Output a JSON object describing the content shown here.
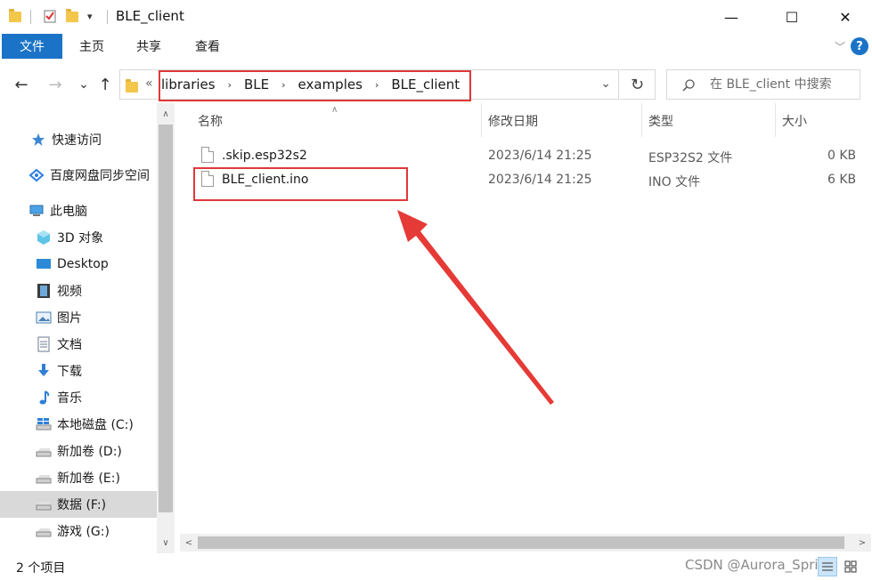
{
  "window": {
    "title": "BLE_client",
    "quick_access_dropdown": "▾",
    "minimize_glyph": "—",
    "maximize_glyph": "☐",
    "close_glyph": "✕"
  },
  "ribbon": {
    "tabs": [
      "文件",
      "主页",
      "共享",
      "查看"
    ],
    "collapse_glyph": "﹀",
    "help_glyph": "?"
  },
  "nav": {
    "back_glyph": "←",
    "forward_glyph": "→",
    "recent_glyph": "⌄",
    "up_glyph": "↑",
    "overflow_glyph": "«",
    "breadcrumbs": [
      "libraries",
      "BLE",
      "examples",
      "BLE_client"
    ],
    "crumb_separator": "›",
    "address_dropdown_glyph": "⌄",
    "refresh_glyph": "↻",
    "search_placeholder": "在 BLE_client 中搜索"
  },
  "sidebar": {
    "items": [
      {
        "label": "快速访问",
        "icon": "star-icon"
      },
      {
        "label": "百度网盘同步空间",
        "icon": "baidu-cloud-icon"
      },
      {
        "label": "此电脑",
        "icon": "computer-icon"
      },
      {
        "label": "3D 对象",
        "icon": "cube-icon"
      },
      {
        "label": "Desktop",
        "icon": "desktop-icon"
      },
      {
        "label": "视频",
        "icon": "film-icon"
      },
      {
        "label": "图片",
        "icon": "picture-icon"
      },
      {
        "label": "文档",
        "icon": "document-icon"
      },
      {
        "label": "下载",
        "icon": "download-icon"
      },
      {
        "label": "音乐",
        "icon": "music-icon"
      },
      {
        "label": "本地磁盘 (C:)",
        "icon": "windows-drive-icon"
      },
      {
        "label": "新加卷 (D:)",
        "icon": "drive-icon"
      },
      {
        "label": "新加卷 (E:)",
        "icon": "drive-icon"
      },
      {
        "label": "数据 (F:)",
        "icon": "drive-icon",
        "selected": true
      },
      {
        "label": "游戏 (G:)",
        "icon": "drive-icon"
      }
    ],
    "scroll_up_glyph": "∧",
    "scroll_down_glyph": "∨"
  },
  "file_list": {
    "columns": [
      "名称",
      "修改日期",
      "类型",
      "大小"
    ],
    "sort_caret": "∧",
    "rows": [
      {
        "name": ".skip.esp32s2",
        "modified": "2023/6/14 21:25",
        "type": "ESP32S2 文件",
        "size": "0 KB"
      },
      {
        "name": "BLE_client.ino",
        "modified": "2023/6/14 21:25",
        "type": "INO 文件",
        "size": "6 KB"
      }
    ],
    "scroll_left_glyph": "<",
    "scroll_right_glyph": ">"
  },
  "status": {
    "item_count": "2 个项目",
    "watermark": "CSDN @Aurora_Spring"
  },
  "colors": {
    "accent": "#1a73c7",
    "highlight_red": "#e0383a",
    "selection_gray": "#d9d9d9"
  }
}
